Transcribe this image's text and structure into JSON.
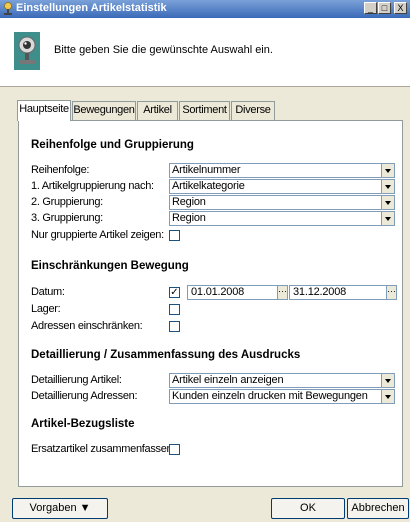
{
  "window": {
    "title": "Einstellungen Artikelstatistik",
    "minimize": "_",
    "maximize": "□",
    "close": "X"
  },
  "header": {
    "instruction": "Bitte geben Sie die gewünschte Auswahl ein."
  },
  "tabs": [
    {
      "label": "Hauptseite",
      "active": true
    },
    {
      "label": "Bewegungen",
      "active": false
    },
    {
      "label": "Artikel",
      "active": false
    },
    {
      "label": "Sortiment",
      "active": false
    },
    {
      "label": "Diverse",
      "active": false
    }
  ],
  "sections": {
    "gruppierung": {
      "title": "Reihenfolge und Gruppierung",
      "reihenfolge_label": "Reihenfolge:",
      "reihenfolge_value": "Artikelnummer",
      "gruppe1_label": "1. Artikelgruppierung nach:",
      "gruppe1_value": "Artikelkategorie",
      "gruppe2_label": "2. Gruppierung:",
      "gruppe2_value": "Region",
      "gruppe3_label": "3. Gruppierung:",
      "gruppe3_value": "Region",
      "nur_gruppierte_label": "Nur gruppierte Artikel zeigen:",
      "nur_gruppierte_checked": false
    },
    "bewegung": {
      "title": "Einschränkungen Bewegung",
      "datum_label": "Datum:",
      "datum_checked": true,
      "datum_von": "01.01.2008",
      "datum_bis": "31.12.2008",
      "lager_label": "Lager:",
      "lager_checked": false,
      "adressen_label": "Adressen einschränken:",
      "adressen_checked": false
    },
    "detail": {
      "title": "Detaillierung / Zusammenfassung des Ausdrucks",
      "artikel_label": "Detaillierung Artikel:",
      "artikel_value": "Artikel einzeln anzeigen",
      "adressen_label": "Detaillierung Adressen:",
      "adressen_value": "Kunden einzeln drucken mit Bewegungen"
    },
    "bezug": {
      "title": "Artikel-Bezugsliste",
      "ersatz_label": "Ersatzartikel zusammenfassen:",
      "ersatz_checked": false
    }
  },
  "buttons": {
    "vorgaben": "Vorgaben ▼",
    "ok": "OK",
    "abbrechen": "Abbrechen"
  },
  "colors": {
    "titlebar": "#3a6ab8",
    "dialog_bg": "#ece9d8",
    "panel_bg": "#ffffff",
    "field_border": "#7f9db9"
  }
}
